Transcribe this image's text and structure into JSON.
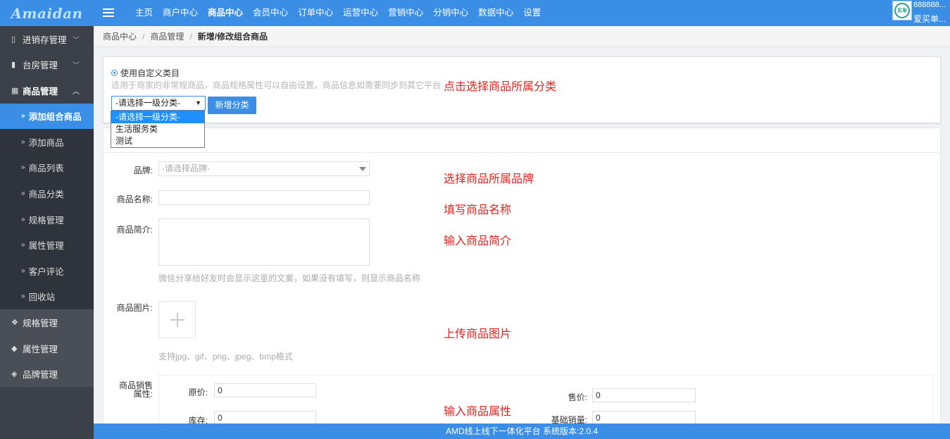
{
  "header": {
    "logo": "Amaidan",
    "nav": [
      "主页",
      "商户中心",
      "商品中心",
      "会员中心",
      "订单中心",
      "运营中心",
      "营销中心",
      "分销中心",
      "数据中心",
      "设置"
    ],
    "active_nav": "商品中心",
    "user": {
      "id": "888888...",
      "name": "爱买单...",
      "avatar_text": "买单"
    }
  },
  "sidebar": {
    "groups_top": [
      {
        "label": "进销存管理",
        "icon": "map-icon",
        "chevron": "﹀"
      },
      {
        "label": "台房管理",
        "icon": "bookmark-icon",
        "chevron": "﹀"
      },
      {
        "label": "商品管理",
        "icon": "grid-icon",
        "chevron": "︿"
      }
    ],
    "sub_items": [
      "添加组合商品",
      "添加商品",
      "商品列表",
      "商品分类",
      "规格管理",
      "属性管理",
      "客户评论",
      "回收站"
    ],
    "active_sub": "添加组合商品",
    "groups_bottom": [
      {
        "label": "规格管理",
        "icon": "cubes-icon"
      },
      {
        "label": "属性管理",
        "icon": "cube-icon"
      },
      {
        "label": "品牌管理",
        "icon": "tags-icon"
      }
    ]
  },
  "breadcrumb": [
    "商品中心",
    "商品管理",
    "新增/修改组合商品"
  ],
  "category": {
    "radio_label": "使用自定义类目",
    "tip": "适用于商家的非常规商品，商品规格属性可以自由设置。商品信息如需要同步到其它平台",
    "select_value": "-请选择一级分类-",
    "add_button": "新增分类",
    "options": [
      "-请选择一级分类-",
      "生活服务类",
      "测试"
    ]
  },
  "notes": {
    "category": "点击选择商品所属分类",
    "brand": "选择商品所属品牌",
    "name": "填写商品名称",
    "intro": "输入商品简介",
    "image": "上传商品图片",
    "attrs": "输入商品属性"
  },
  "form": {
    "brand_label": "品牌:",
    "brand_placeholder": "-请选择品牌-",
    "name_label": "商品名称:",
    "intro_label": "商品简介:",
    "intro_help": "微信分享给好友时会显示这里的文案，如果没有填写，则显示商品名称",
    "image_label": "商品图片:",
    "image_help": "支持jpg、gif、png、jpeg、bmp格式",
    "sales_label_1": "商品销售",
    "sales_label_2": "属性:",
    "orig_price_label": "原价:",
    "orig_price_value": "0",
    "price_label": "售价:",
    "price_value": "0",
    "stock_label": "库存:",
    "stock_value": "0",
    "base_sales_label": "基础销量:",
    "base_sales_value": "0"
  },
  "footer": "AMD线上线下一体化平台 系统版本:2.0.4"
}
